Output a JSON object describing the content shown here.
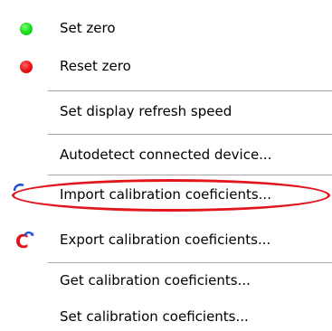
{
  "menu": {
    "items": [
      {
        "label": "Set zero",
        "icon": "green-dot-icon"
      },
      {
        "label": "Reset zero",
        "icon": "red-dot-icon"
      },
      {
        "label": "Set display refresh speed"
      },
      {
        "label": "Autodetect connected device..."
      },
      {
        "label": "Import calibration coeficients...",
        "icon": "import-c-icon",
        "highlighted": true
      },
      {
        "label": "Export calibration coeficients...",
        "icon": "export-c-icon"
      },
      {
        "label": "Get calibration coeficients..."
      },
      {
        "label": "Set calibration coeficients..."
      }
    ]
  },
  "colors": {
    "highlight_ellipse": "#e2141c",
    "green_dot": "#22e022",
    "red_dot": "#ee1b1b",
    "c_icon_red": "#e2141c",
    "c_icon_blue": "#1f4fd6",
    "separator": "#a7a6aa"
  }
}
